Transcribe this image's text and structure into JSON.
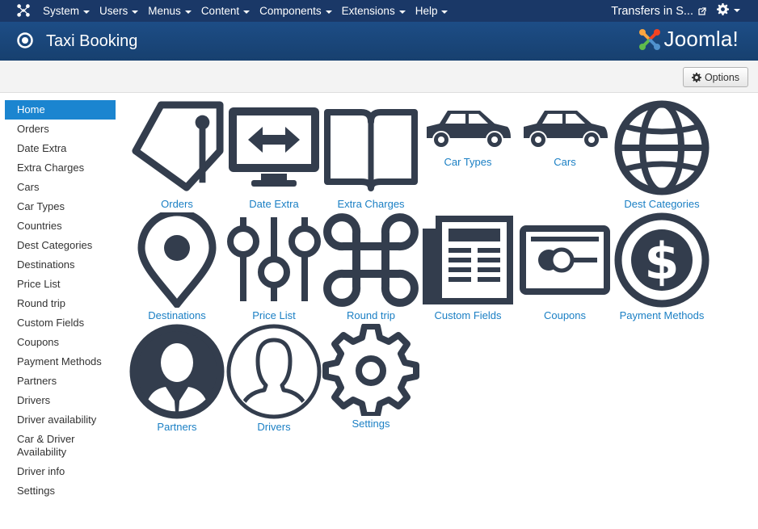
{
  "topbar": {
    "menu": [
      "System",
      "Users",
      "Menus",
      "Content",
      "Components",
      "Extensions",
      "Help"
    ],
    "site_link": "Transfers in S..."
  },
  "header": {
    "title": "Taxi Booking",
    "brand": "Joomla!"
  },
  "toolbar": {
    "options_label": "Options"
  },
  "sidebar": {
    "items": [
      {
        "label": "Home"
      },
      {
        "label": "Orders"
      },
      {
        "label": "Date Extra"
      },
      {
        "label": "Extra Charges"
      },
      {
        "label": "Cars"
      },
      {
        "label": "Car Types"
      },
      {
        "label": "Countries"
      },
      {
        "label": "Dest Categories"
      },
      {
        "label": "Destinations"
      },
      {
        "label": "Price List"
      },
      {
        "label": "Round trip"
      },
      {
        "label": "Custom Fields"
      },
      {
        "label": "Coupons"
      },
      {
        "label": "Payment Methods"
      },
      {
        "label": "Partners"
      },
      {
        "label": "Drivers"
      },
      {
        "label": "Driver availability"
      },
      {
        "label": "Car & Driver Availability"
      },
      {
        "label": "Driver info"
      },
      {
        "label": "Settings"
      }
    ],
    "active_index": 0
  },
  "dashboard": {
    "tiles": [
      {
        "label": "Orders",
        "icon": "tag-icon"
      },
      {
        "label": "Date Extra",
        "icon": "monitor-arrows-icon"
      },
      {
        "label": "Extra Charges",
        "icon": "book-icon"
      },
      {
        "label": "Car Types",
        "icon": "car-icon"
      },
      {
        "label": "Cars",
        "icon": "car-icon"
      },
      {
        "label": "Dest Categories",
        "icon": "globe-icon"
      },
      {
        "label": "Destinations",
        "icon": "map-pin-icon"
      },
      {
        "label": "Price List",
        "icon": "sliders-icon"
      },
      {
        "label": "Round trip",
        "icon": "command-icon"
      },
      {
        "label": "Custom Fields",
        "icon": "newspaper-icon"
      },
      {
        "label": "Coupons",
        "icon": "card-icon"
      },
      {
        "label": "Payment Methods",
        "icon": "dollar-circle-icon"
      },
      {
        "label": "Partners",
        "icon": "business-user-icon"
      },
      {
        "label": "Drivers",
        "icon": "user-outline-icon"
      },
      {
        "label": "Settings",
        "icon": "settings-gear-icon"
      }
    ]
  },
  "colors": {
    "topbar": "#1a3867",
    "header": "#1d4d86",
    "link": "#1a7fc4",
    "active": "#1b85d0",
    "icon": "#333d4d"
  }
}
